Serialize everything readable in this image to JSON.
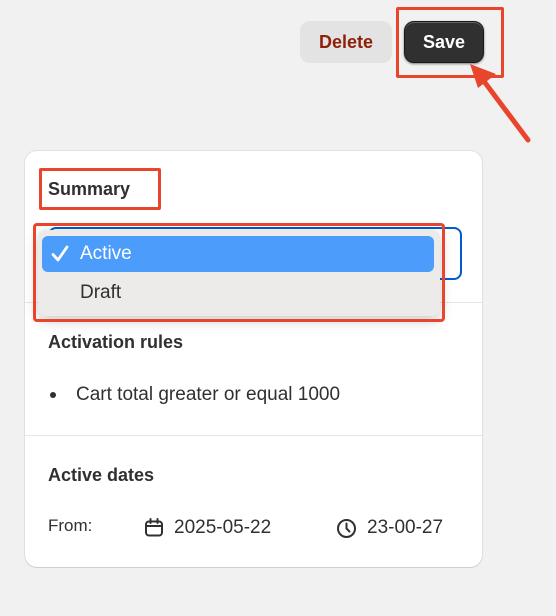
{
  "toolbar": {
    "delete_label": "Delete",
    "save_label": "Save"
  },
  "summary": {
    "title": "Summary",
    "status_select": {
      "options": [
        {
          "label": "Active",
          "selected": true
        },
        {
          "label": "Draft",
          "selected": false
        }
      ]
    }
  },
  "activation_rules": {
    "title": "Activation rules",
    "items": [
      "Cart total greater or equal 1000"
    ]
  },
  "active_dates": {
    "title": "Active dates",
    "from_label": "From:",
    "date": "2025-05-22",
    "time": "23-00-27"
  },
  "colors": {
    "background": "#f1f1f1",
    "delete_text": "#8e1f0b",
    "save_bg": "#303030",
    "selected_option": "#4b9cfb",
    "select_border": "#005bd3",
    "annotation": "#e8452c"
  },
  "icons": [
    "checkmark-icon",
    "calendar-icon",
    "clock-icon",
    "arrow-annotation"
  ]
}
